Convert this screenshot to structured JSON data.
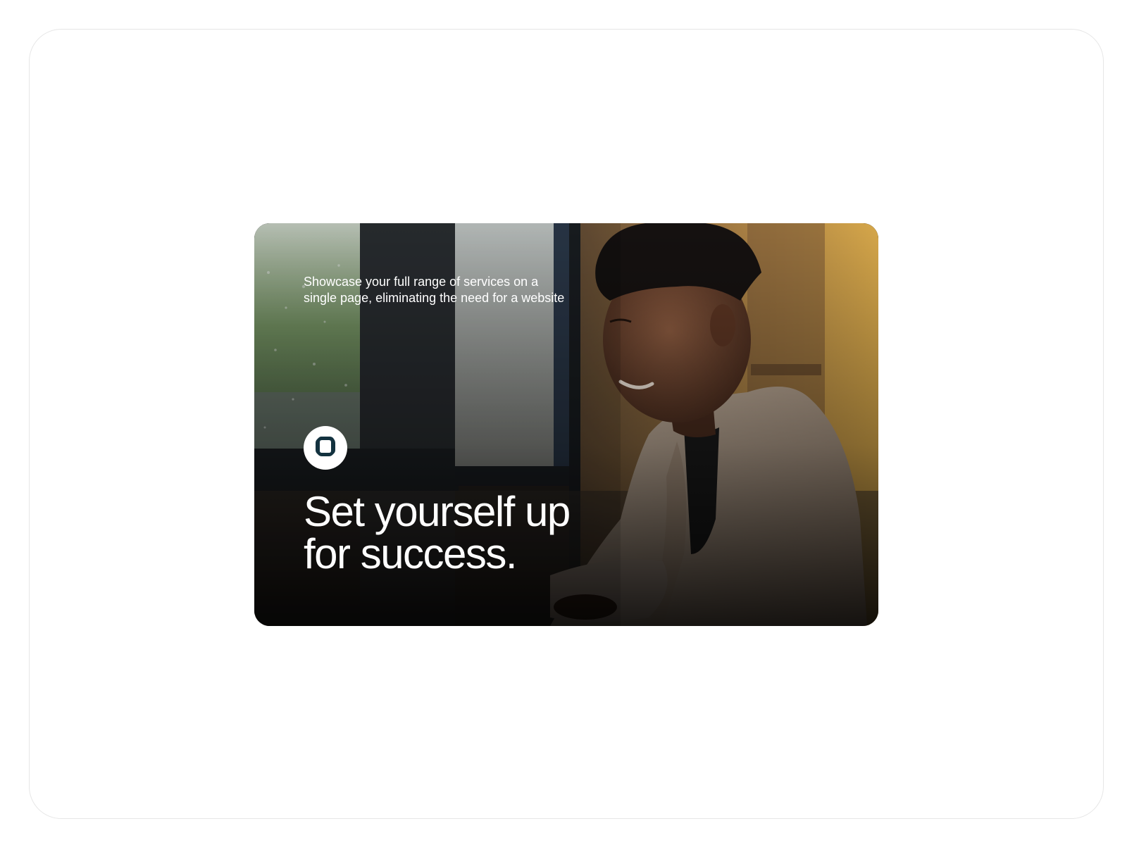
{
  "hero": {
    "tagline_line1": "Showcase your full range of services on a",
    "tagline_line2": "single page, eliminating the need for a website",
    "headline_line1": "Set yourself up",
    "headline_line2": "for success.",
    "logo_icon": "rounded-octagon-logo-icon"
  },
  "colors": {
    "page_background": "#ffffff",
    "frame_border": "#e6e6e6",
    "text": "#ffffff",
    "logo_badge": "#ffffff",
    "logo_mark": "#13323f"
  }
}
